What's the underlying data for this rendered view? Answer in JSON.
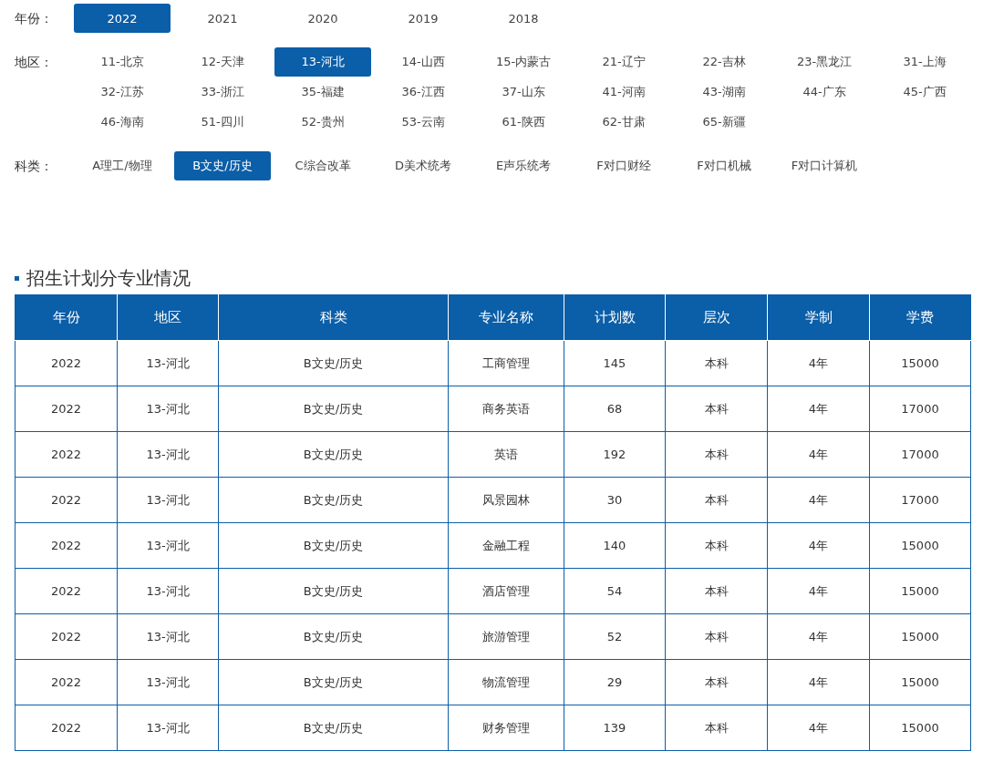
{
  "filters": [
    {
      "label": "年份：",
      "options": [
        {
          "text": "2022",
          "selected": true
        },
        {
          "text": "2021",
          "selected": false
        },
        {
          "text": "2020",
          "selected": false
        },
        {
          "text": "2019",
          "selected": false
        },
        {
          "text": "2018",
          "selected": false
        }
      ]
    },
    {
      "label": "地区：",
      "options": [
        {
          "text": "11-北京",
          "selected": false
        },
        {
          "text": "12-天津",
          "selected": false
        },
        {
          "text": "13-河北",
          "selected": true
        },
        {
          "text": "14-山西",
          "selected": false
        },
        {
          "text": "15-内蒙古",
          "selected": false
        },
        {
          "text": "21-辽宁",
          "selected": false
        },
        {
          "text": "22-吉林",
          "selected": false
        },
        {
          "text": "23-黑龙江",
          "selected": false
        },
        {
          "text": "31-上海",
          "selected": false
        },
        {
          "text": "32-江苏",
          "selected": false
        },
        {
          "text": "33-浙江",
          "selected": false
        },
        {
          "text": "35-福建",
          "selected": false
        },
        {
          "text": "36-江西",
          "selected": false
        },
        {
          "text": "37-山东",
          "selected": false
        },
        {
          "text": "41-河南",
          "selected": false
        },
        {
          "text": "43-湖南",
          "selected": false
        },
        {
          "text": "44-广东",
          "selected": false
        },
        {
          "text": "45-广西",
          "selected": false
        },
        {
          "text": "46-海南",
          "selected": false
        },
        {
          "text": "51-四川",
          "selected": false
        },
        {
          "text": "52-贵州",
          "selected": false
        },
        {
          "text": "53-云南",
          "selected": false
        },
        {
          "text": "61-陕西",
          "selected": false
        },
        {
          "text": "62-甘肃",
          "selected": false
        },
        {
          "text": "65-新疆",
          "selected": false
        }
      ]
    },
    {
      "label": "科类：",
      "options": [
        {
          "text": "A理工/物理",
          "selected": false
        },
        {
          "text": "B文史/历史",
          "selected": true
        },
        {
          "text": "C综合改革",
          "selected": false
        },
        {
          "text": "D美术统考",
          "selected": false
        },
        {
          "text": "E声乐统考",
          "selected": false
        },
        {
          "text": "F对口财经",
          "selected": false
        },
        {
          "text": "F对口机械",
          "selected": false
        },
        {
          "text": "F对口计算机",
          "selected": false
        }
      ]
    }
  ],
  "section_title": "招生计划分专业情况",
  "table": {
    "columns": [
      "年份",
      "地区",
      "科类",
      "专业名称",
      "计划数",
      "层次",
      "学制",
      "学费"
    ],
    "rows": [
      [
        "2022",
        "13-河北",
        "B文史/历史",
        "工商管理",
        "145",
        "本科",
        "4年",
        "15000"
      ],
      [
        "2022",
        "13-河北",
        "B文史/历史",
        "商务英语",
        "68",
        "本科",
        "4年",
        "17000"
      ],
      [
        "2022",
        "13-河北",
        "B文史/历史",
        "英语",
        "192",
        "本科",
        "4年",
        "17000"
      ],
      [
        "2022",
        "13-河北",
        "B文史/历史",
        "风景园林",
        "30",
        "本科",
        "4年",
        "17000"
      ],
      [
        "2022",
        "13-河北",
        "B文史/历史",
        "金融工程",
        "140",
        "本科",
        "4年",
        "15000"
      ],
      [
        "2022",
        "13-河北",
        "B文史/历史",
        "酒店管理",
        "54",
        "本科",
        "4年",
        "15000"
      ],
      [
        "2022",
        "13-河北",
        "B文史/历史",
        "旅游管理",
        "52",
        "本科",
        "4年",
        "15000"
      ],
      [
        "2022",
        "13-河北",
        "B文史/历史",
        "物流管理",
        "29",
        "本科",
        "4年",
        "15000"
      ],
      [
        "2022",
        "13-河北",
        "B文史/历史",
        "财务管理",
        "139",
        "本科",
        "4年",
        "15000"
      ]
    ]
  }
}
